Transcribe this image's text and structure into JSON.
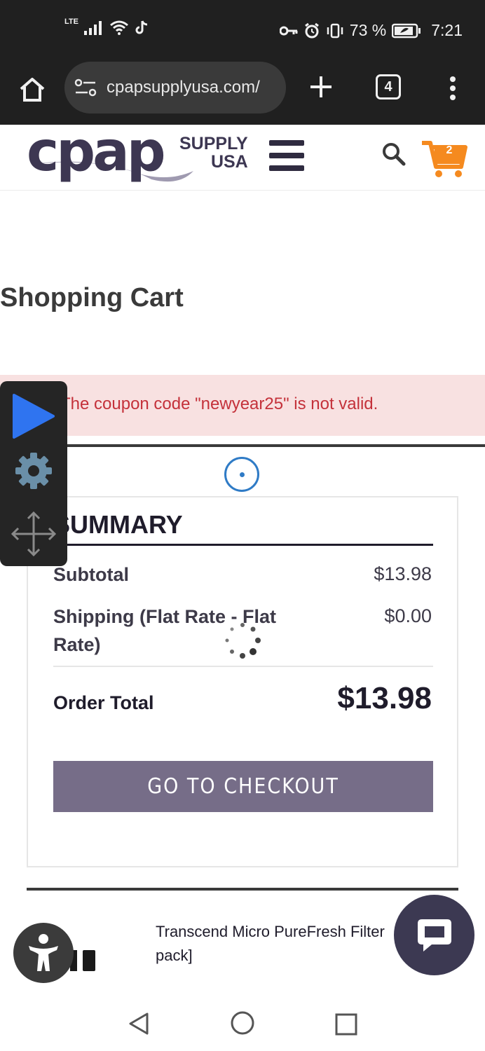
{
  "status_bar": {
    "network": "LTE",
    "battery": "73 %",
    "time": "7:21"
  },
  "browser": {
    "url": "cpapsupplyusa.com/",
    "tab_count": "4"
  },
  "header": {
    "logo_word": "cpap",
    "logo_supply": "SUPPLY",
    "logo_usa": "USA",
    "cart_count": "2"
  },
  "page": {
    "title": "Shopping Cart",
    "error_message": "The coupon code \"newyear25\" is not valid."
  },
  "summary": {
    "heading": "SUMMARY",
    "subtotal_label": "Subtotal",
    "subtotal_value": "$13.98",
    "shipping_label_line1": "Shipping (Flat Rate - Flat",
    "shipping_label_line2": "Rate)",
    "shipping_value": "$0.00",
    "total_label": "Order Total",
    "total_value": "$13.98",
    "checkout_label": "GO TO CHECKOUT"
  },
  "product": {
    "name_line1": "Transcend Micro PureFresh Filter",
    "name_line2": "pack]"
  },
  "colors": {
    "accent_orange": "#f58a1f",
    "brand_purple": "#3d3752",
    "checkout_button": "#766d88",
    "error_text": "#c4313a",
    "error_background": "#f8e1e1"
  }
}
